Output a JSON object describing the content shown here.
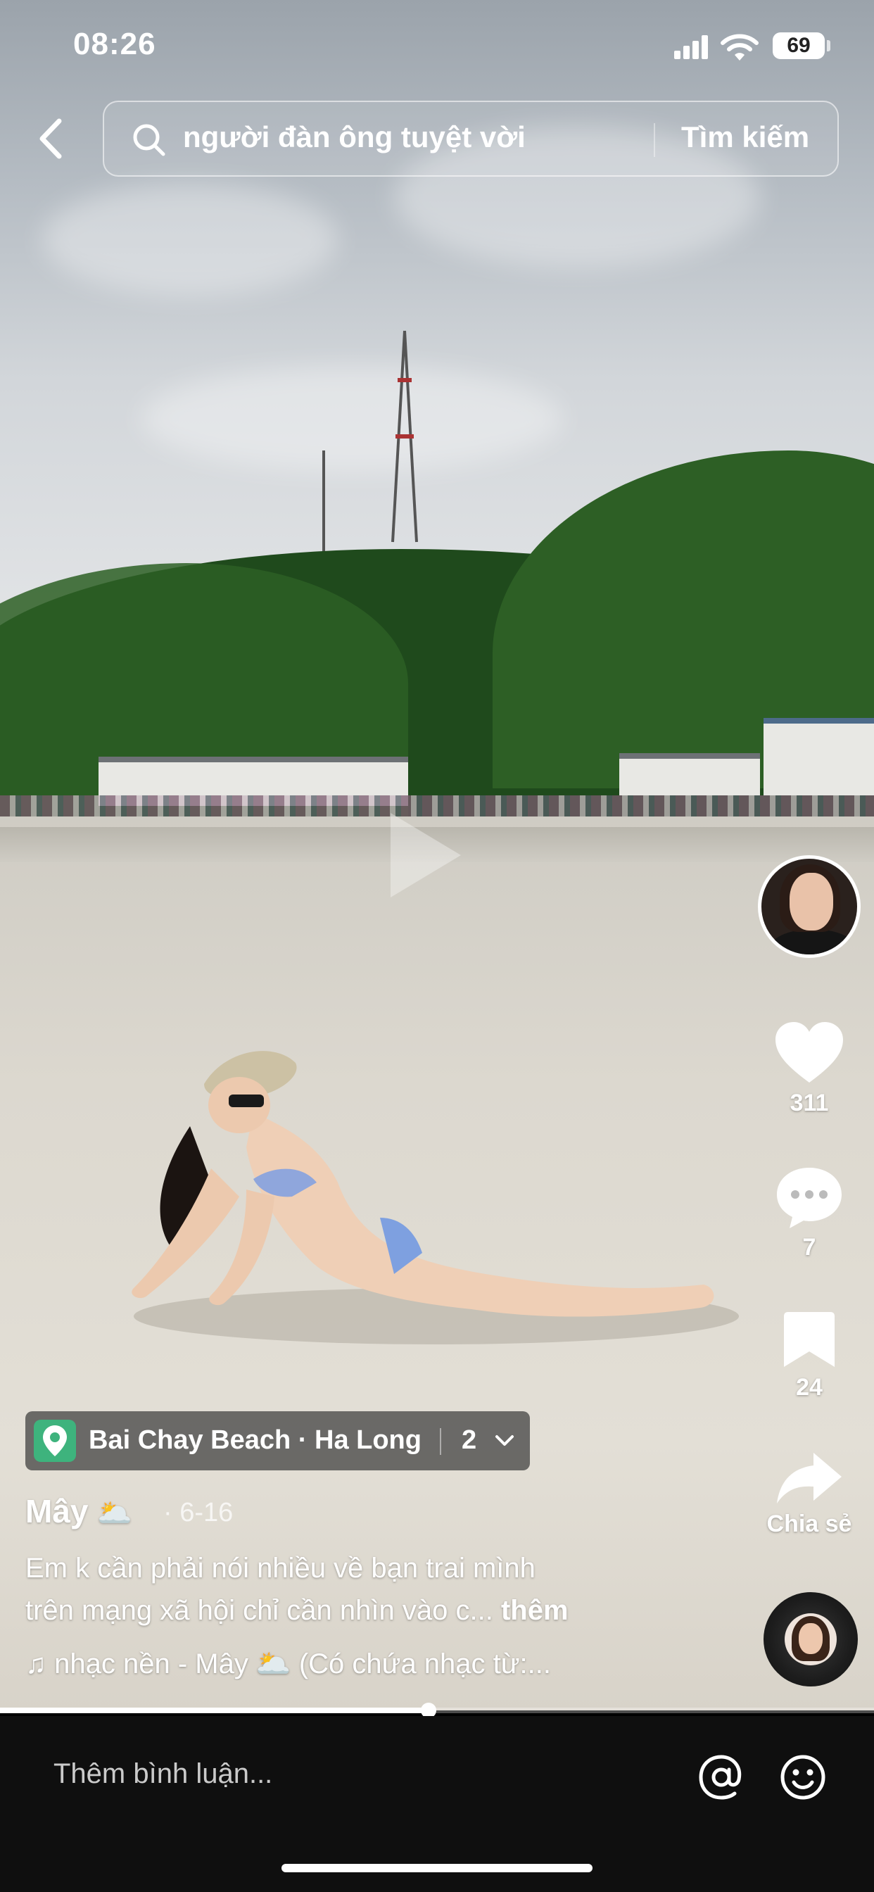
{
  "status_bar": {
    "time": "08:26",
    "battery": "69"
  },
  "search": {
    "query": "người đàn ông tuyệt vời",
    "submit_label": "Tìm kiếm"
  },
  "video": {
    "progress": 0.49
  },
  "rail": {
    "likes": "311",
    "comments": "7",
    "saves": "24",
    "share_label": "Chia sẻ"
  },
  "location": {
    "name": "Bai Chay Beach · Ha Long",
    "count": "2"
  },
  "post": {
    "author": "Mây",
    "author_emoji": "🌥️",
    "date": "· 6-16",
    "caption_line1": "Em k cần phải nói nhiều về bạn trai mình",
    "caption_line2": "trên mạng xã hội chỉ cần nhìn vào c...",
    "more_label": "thêm",
    "music": "♫ nhạc nền - Mây 🌥️ (Có chứa nhạc từ:..."
  },
  "comment_bar": {
    "placeholder": "Thêm bình luận..."
  },
  "colors": {
    "location_icon": "#3eb37d",
    "comment_bar_bg": "#0f0f0f"
  }
}
